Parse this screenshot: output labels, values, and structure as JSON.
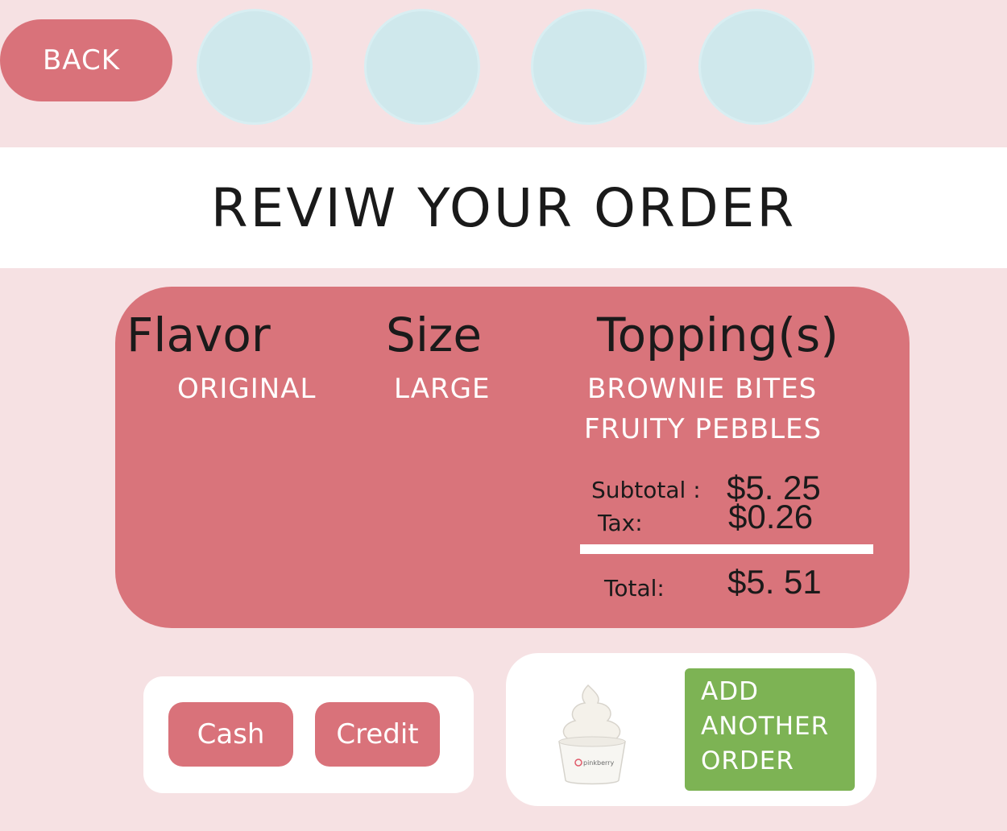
{
  "nav": {
    "back_label": "BACK"
  },
  "header": {
    "title": "REVIW YOUR ORDER"
  },
  "order": {
    "headers": {
      "flavor": "Flavor",
      "size": "Size",
      "toppings": "Topping(s)"
    },
    "flavor": "ORIGINAL",
    "size": "LARGE",
    "toppings": [
      "BROWNIE BITES",
      "FRUITY PEBBLES"
    ],
    "subtotal_label": "Subtotal :",
    "subtotal_value": "$5. 25",
    "tax_label": "Tax:",
    "tax_value": "$0.26",
    "total_label": "Total:",
    "total_value": "$5. 51"
  },
  "payment": {
    "cash_label": "Cash",
    "credit_label": "Credit"
  },
  "add_order": {
    "label": "ADD\nANOTHER\nORDER",
    "cup_brand": "pinkberry"
  },
  "colors": {
    "accent": "#d9727a",
    "background": "#f6e1e3",
    "step": "#cfe8ec",
    "add_button": "#7db354"
  },
  "icons": {
    "cup": "frozen-yogurt-cup-icon"
  }
}
